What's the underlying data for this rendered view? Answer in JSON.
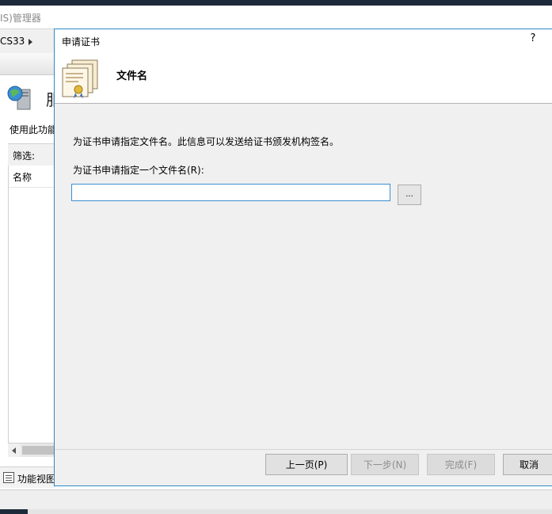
{
  "background_window": {
    "title": "IS)管理器",
    "address_crumb": "CS33",
    "page_heading": "服",
    "page_description": "使用此功能",
    "filter_label": "筛选:",
    "column_name": "名称",
    "view_tab_label": "功能视图"
  },
  "dialog": {
    "title": "申请证书",
    "help_label": "?",
    "heading": "文件名",
    "description": "为证书申请指定文件名。此信息可以发送给证书颁发机构签名。",
    "filename_label": "为证书申请指定一个文件名(R):",
    "filename_value": "",
    "browse_label": "...",
    "buttons": {
      "prev": "上一页(P)",
      "next": "下一步(N)",
      "finish": "完成(F)",
      "cancel": "取消"
    }
  },
  "colors": {
    "accent_border": "#2f88c8",
    "dialog_bg": "#f0f0f0",
    "disabled_text": "#8d8d8d"
  }
}
